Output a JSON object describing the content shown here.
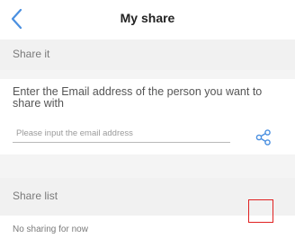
{
  "nav": {
    "title": "My share",
    "back_icon": "chevron-left-icon"
  },
  "share_it": {
    "heading": "Share it",
    "instruction": "Enter the Email address of the person you want to share with",
    "email_input": {
      "value": "",
      "placeholder": "Please input the email address"
    },
    "share_icon": "share-icon"
  },
  "share_list": {
    "heading": "Share list",
    "empty_message": "No sharing for now"
  },
  "colors": {
    "accent": "#4a8fe0",
    "marker": "#e02020",
    "background": "#f4f4f4",
    "text_muted": "#7a7a7a"
  }
}
